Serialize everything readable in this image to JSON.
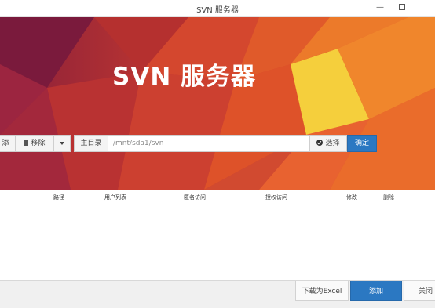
{
  "window": {
    "title": "SVN 服务器"
  },
  "banner": {
    "title": "SVN 服务器"
  },
  "toolbar": {
    "add_label": "添",
    "delete_label": "移除",
    "root_label": "主目录",
    "path_value": "/mnt/sda1/svn",
    "select_label": "选择",
    "confirm_label": "确定"
  },
  "table": {
    "columns": [
      "路径",
      "用户列表",
      "匿名访问",
      "授权访问",
      "修改",
      "删除"
    ]
  },
  "footer": {
    "excel_label": "下载为Excel",
    "add_label": "添加",
    "close_label": "关闭"
  },
  "colors": {
    "accent": "#2b78c2"
  }
}
